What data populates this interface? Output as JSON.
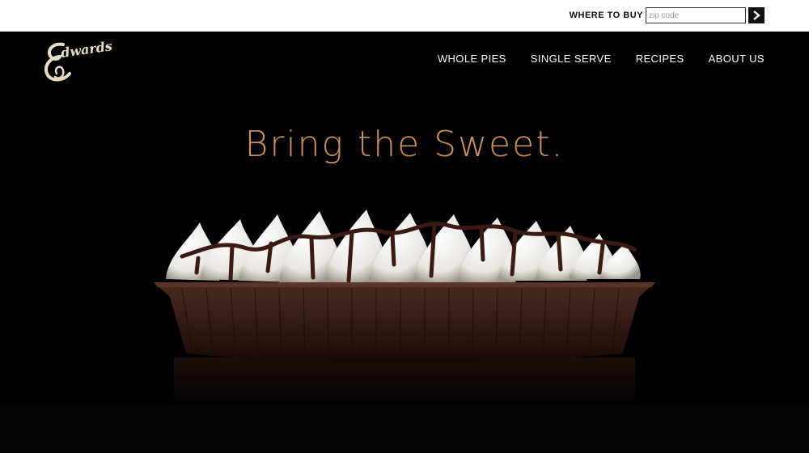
{
  "topbar": {
    "where_to_buy_label": "WHERE TO BUY",
    "zip_placeholder": "zip code",
    "zip_value": ""
  },
  "header": {
    "logo_text": "Edwards",
    "nav": [
      {
        "label": "WHOLE PIES"
      },
      {
        "label": "SINGLE SERVE"
      },
      {
        "label": "RECIPES"
      },
      {
        "label": "ABOUT US"
      }
    ]
  },
  "hero": {
    "headline": "Bring the Sweet."
  },
  "colors": {
    "headline": "#c8925a",
    "logo": "#e8dcc4",
    "background": "#000000",
    "crust": "#3b1f18"
  },
  "icons": {
    "go_button": "chevron-right-icon"
  }
}
